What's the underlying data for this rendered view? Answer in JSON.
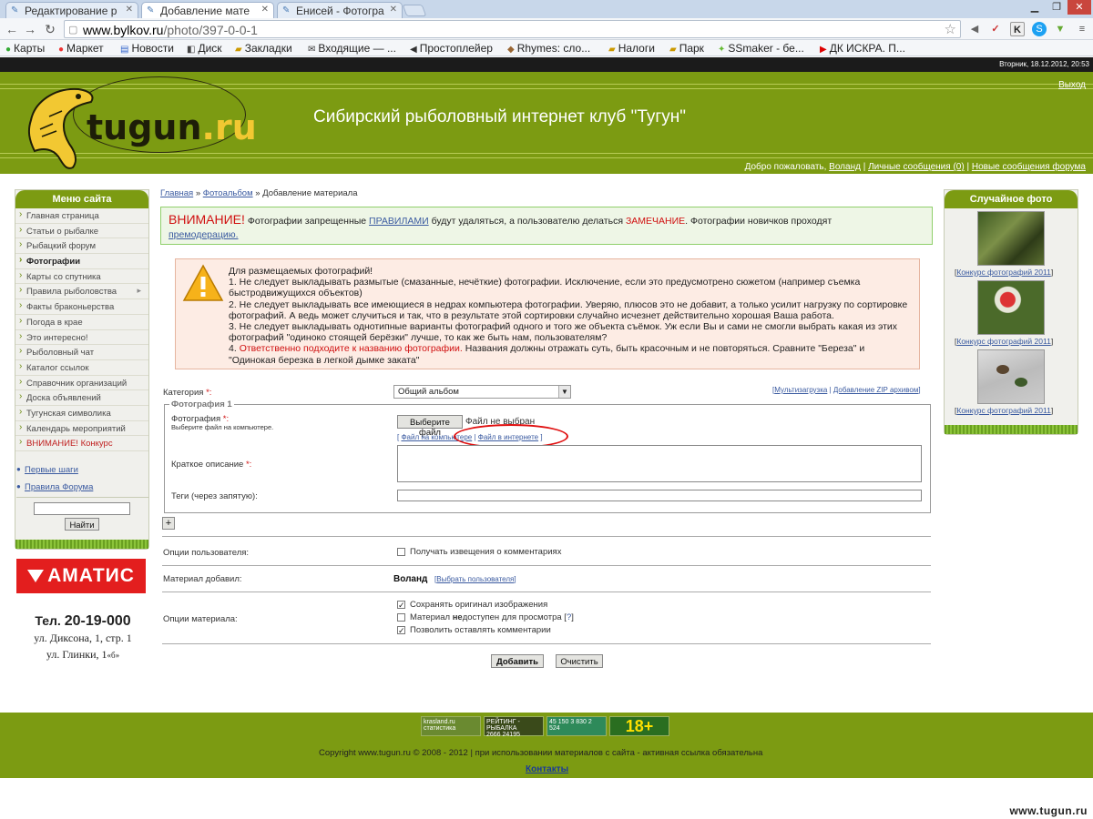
{
  "browser": {
    "tabs": [
      {
        "label": "Редактирование р",
        "active": false
      },
      {
        "label": "Добавление мате",
        "active": true
      },
      {
        "label": "Енисей - Фотогра",
        "active": false
      }
    ],
    "url_host": "www.bylkov.ru",
    "url_path": "/photo/397-0-0-1",
    "bookmarks": [
      "Карты",
      "Маркет",
      "Новости",
      "Диск",
      "Закладки",
      "Входящие — ...",
      "Простоплейер",
      "Rhymes: сло...",
      "Налоги",
      "Парк",
      "SSmaker - бе...",
      "ДК ИСКРА. П..."
    ]
  },
  "site": {
    "datetime": "Вторник, 18.12.2012, 20:53",
    "logo_main": "tugun",
    "logo_dot": ".ru",
    "title": "Сибирский рыболовный интернет клуб \"Тугун\"",
    "logout": "Выход",
    "welcome_prefix": "Добро пожаловать,",
    "welcome_user": "Воланд",
    "sep": "|",
    "messages": "Личные сообщения (0)",
    "forum_msgs": "Новые сообщения форума"
  },
  "left_menu": {
    "title": "Меню сайта",
    "items": [
      {
        "label": "Главная страница",
        "style": ""
      },
      {
        "label": "Статьи о рыбалке",
        "style": ""
      },
      {
        "label": "Рыбацкий форум",
        "style": ""
      },
      {
        "label": "Фотографии",
        "style": "bold"
      },
      {
        "label": "Карты со спутника",
        "style": ""
      },
      {
        "label": "Правила рыболовства",
        "style": "arrow"
      },
      {
        "label": "Факты браконьерства",
        "style": ""
      },
      {
        "label": "Погода в крае",
        "style": ""
      },
      {
        "label": "Это интересно!",
        "style": ""
      },
      {
        "label": "Рыболовный чат",
        "style": ""
      },
      {
        "label": "Каталог ссылок",
        "style": ""
      },
      {
        "label": "Справочник организаций",
        "style": ""
      },
      {
        "label": "Доска объявлений",
        "style": ""
      },
      {
        "label": "Тугунская символика",
        "style": ""
      },
      {
        "label": "Календарь мероприятий",
        "style": ""
      },
      {
        "label": "ВНИМАНИЕ! Конкурс",
        "style": "red"
      }
    ],
    "first_steps": "Первые шаги",
    "forum_rules": "Правила Форума",
    "search_button": "Найти",
    "amatis": "АМАТИС",
    "phone_label": "Тел.",
    "phone": "20-19-000",
    "addr1": "ул. Диксона, 1, стр. 1",
    "addr2": "ул. Глинки, 1",
    "addr2_suffix": "«б»"
  },
  "right_box": {
    "title": "Случайное фото",
    "photo_caption": "Конкурс фотографий 2011"
  },
  "content": {
    "breadcrumb": [
      "Главная",
      "Фотоальбом",
      "Добавление материала"
    ],
    "bc_sep": "»",
    "warning1": {
      "head": "ВНИМАНИЕ!",
      "t1": "Фотографии запрещенные",
      "link1": "ПРАВИЛАМИ",
      "t2": "будут удаляться, а пользователю делаться",
      "red": "ЗАМЕЧАНИЕ",
      "t3": ". Фотографии новичков проходят",
      "link2": "премодерацию."
    },
    "warning2": {
      "l0": "Для размещаемых фотографий!",
      "l1": "1. Не следует выкладывать размытые (смазанные, нечёткие) фотографии. Исключение, если это предусмотрено сюжетом (например съемка быстродвижущихся объектов)",
      "l2": "2. Не следует выкладывать все имеющиеся в недрах компьютера фотографии. Уверяю, плюсов это не добавит, а только усилит нагрузку по сортировке фотографий. А ведь может случиться и так, что в результате этой сортировки случайно исчезнет действительно хорошая Ваша работа.",
      "l3": "3. Не следует выкладывать однотипные варианты фотографий одного и того же объекта съёмок. Уж если Вы и сами не смогли выбрать какая из этих фотографий \"одиноко стоящей берёзки\" лучше, то как же быть нам, пользователям?",
      "l4_prefix": "4.",
      "l4_red": "Ответственно подходите к названию фотографии.",
      "l4_rest": "Названия должны отражать суть, быть красочным и не повторяться. Сравните \"Береза\" и \"Одинокая березка в легкой дымке заката\""
    },
    "form": {
      "category_label": "Категория",
      "asterisk": "*:",
      "category_value": "Общий альбом",
      "multi_upload": "Мультизагрузка",
      "zip_upload": "Добавление ZIP архивом",
      "fieldset_legend": "Фотография 1",
      "photo_label": "Фотография",
      "photo_hint": "Выберите файл на компьютере.",
      "choose_file": "Выберите файл",
      "no_file": "Файл не выбран",
      "file_on_pc": "Файл на компьютере",
      "file_online": "Файл в интернете",
      "desc_label": "Краткое описание",
      "tags_label": "Теги (через запятую):",
      "add_more": "+",
      "user_options": "Опции пользователя:",
      "notify": "Получать извещения о комментариях",
      "added_by": "Материал добавил:",
      "added_user": "Воланд",
      "choose_user": "Выбрать пользователя",
      "material_options": "Опции материала:",
      "opt1": "Сохранять оригинал изображения",
      "opt2_a": "Материал",
      "opt2_b": "не",
      "opt2_c": "доступен для просмотра [",
      "opt2_q": "?",
      "opt2_d": "]",
      "opt3": "Позволить оставлять комментарии",
      "submit": "Добавить",
      "reset": "Очистить"
    }
  },
  "footer": {
    "badge1": "krasland.ru статистика",
    "badge2a": "РЕЙТИНГ - РЫБАЛКА",
    "badge2b": "2666 24195",
    "badge3": "45 150 3 830 2 524",
    "badge4": "18+",
    "copyright": "Copyright www.tugun.ru © 2008 - 2012 | при использовании материалов с сайта - активная ссылка обязательна",
    "contacts": "Контакты",
    "watermark": "www.tugun.ru"
  },
  "colors": {
    "site_green": "#7c9b12",
    "warning_red": "#d01010",
    "link_blue": "#3a5aa0"
  }
}
